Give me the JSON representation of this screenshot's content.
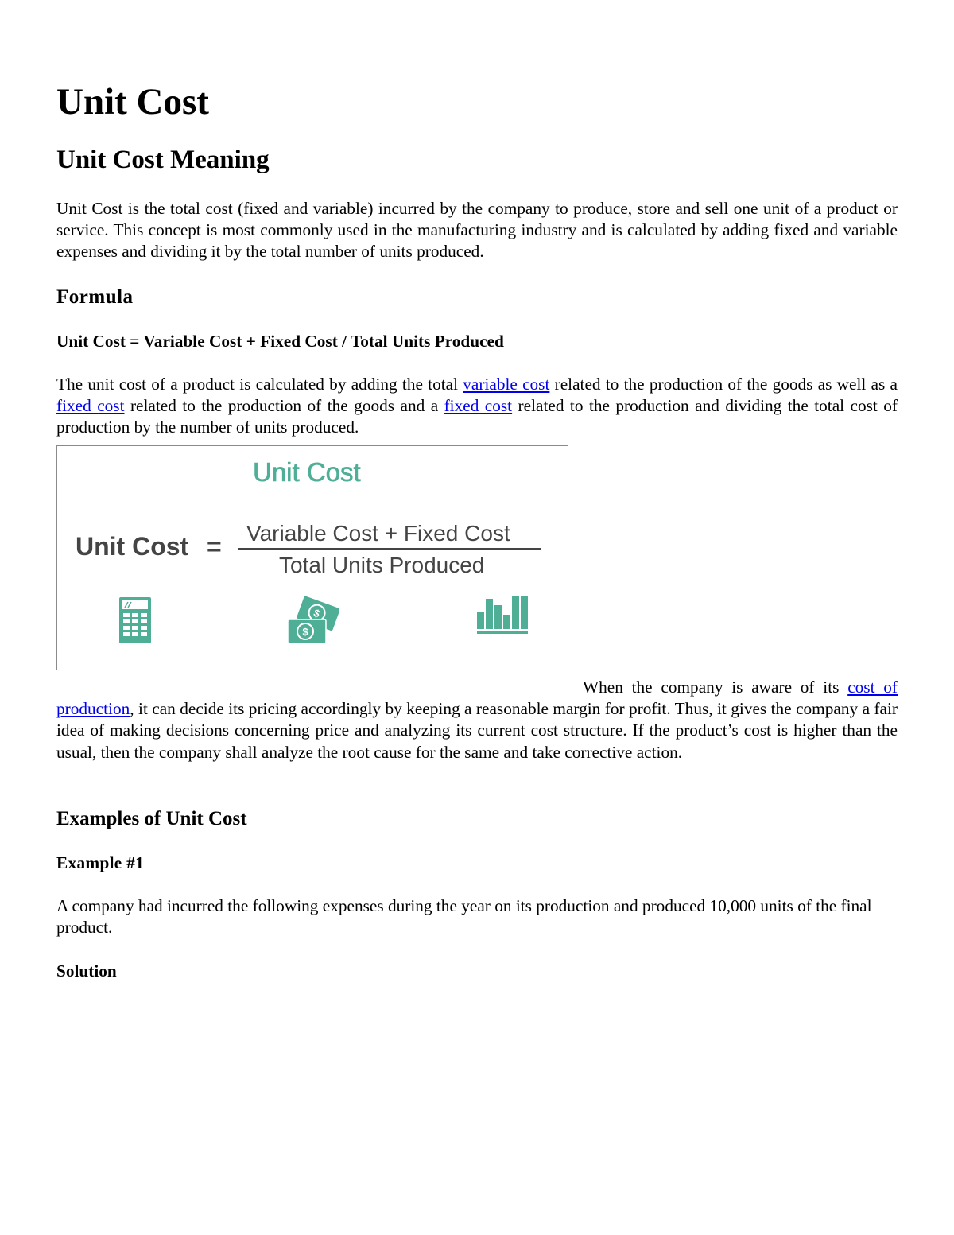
{
  "title": "Unit Cost",
  "meaning_heading": "Unit Cost Meaning",
  "meaning_paragraph": "Unit Cost is the total cost (fixed and variable) incurred by the company to produce, store and sell one unit of a product or service. This concept is most commonly used in the manufacturing industry and is calculated by adding fixed and variable expenses and dividing it by the total number of units produced.",
  "formula_heading": "Formula",
  "formula_line": "Unit Cost = Variable Cost + Fixed Cost / Total Units Produced",
  "explanation": {
    "part1": "The unit cost of a product is calculated by adding the total ",
    "link1": "variable cost",
    "part2": " related to the production of the goods as well as a ",
    "link2": "fixed cost",
    "part3": " related to the production of the goods and a ",
    "link3": "fixed cost",
    "part4": " related to the production and dividing the total cost of production by the number of units produced."
  },
  "figure": {
    "title": "Unit Cost",
    "lhs": "Unit Cost",
    "equals": "=",
    "numerator": "Variable Cost + Fixed Cost",
    "denominator": "Total Units Produced",
    "accent_color": "#4fae96",
    "text_color": "#444444",
    "icons": [
      "calculator-icon",
      "money-bills-icon",
      "bar-chart-icon"
    ]
  },
  "pricing_paragraph": {
    "part1": "When the company is aware of its ",
    "link": "cost of production",
    "part2": ",  it can decide its pricing accordingly by keeping a reasonable margin for profit. Thus, it gives the company a fair idea of making decisions concerning price and analyzing its current cost structure. If the product’s cost is higher than the usual, then the company shall analyze the root cause for the same and take corrective action."
  },
  "examples_heading": "Examples of Unit Cost",
  "example1_heading": "Example #1",
  "example1_text": "A company had incurred the following expenses during the year on its production and produced 10,000 units of the final product.",
  "solution_heading": "Solution",
  "link_color": "#0000ee"
}
